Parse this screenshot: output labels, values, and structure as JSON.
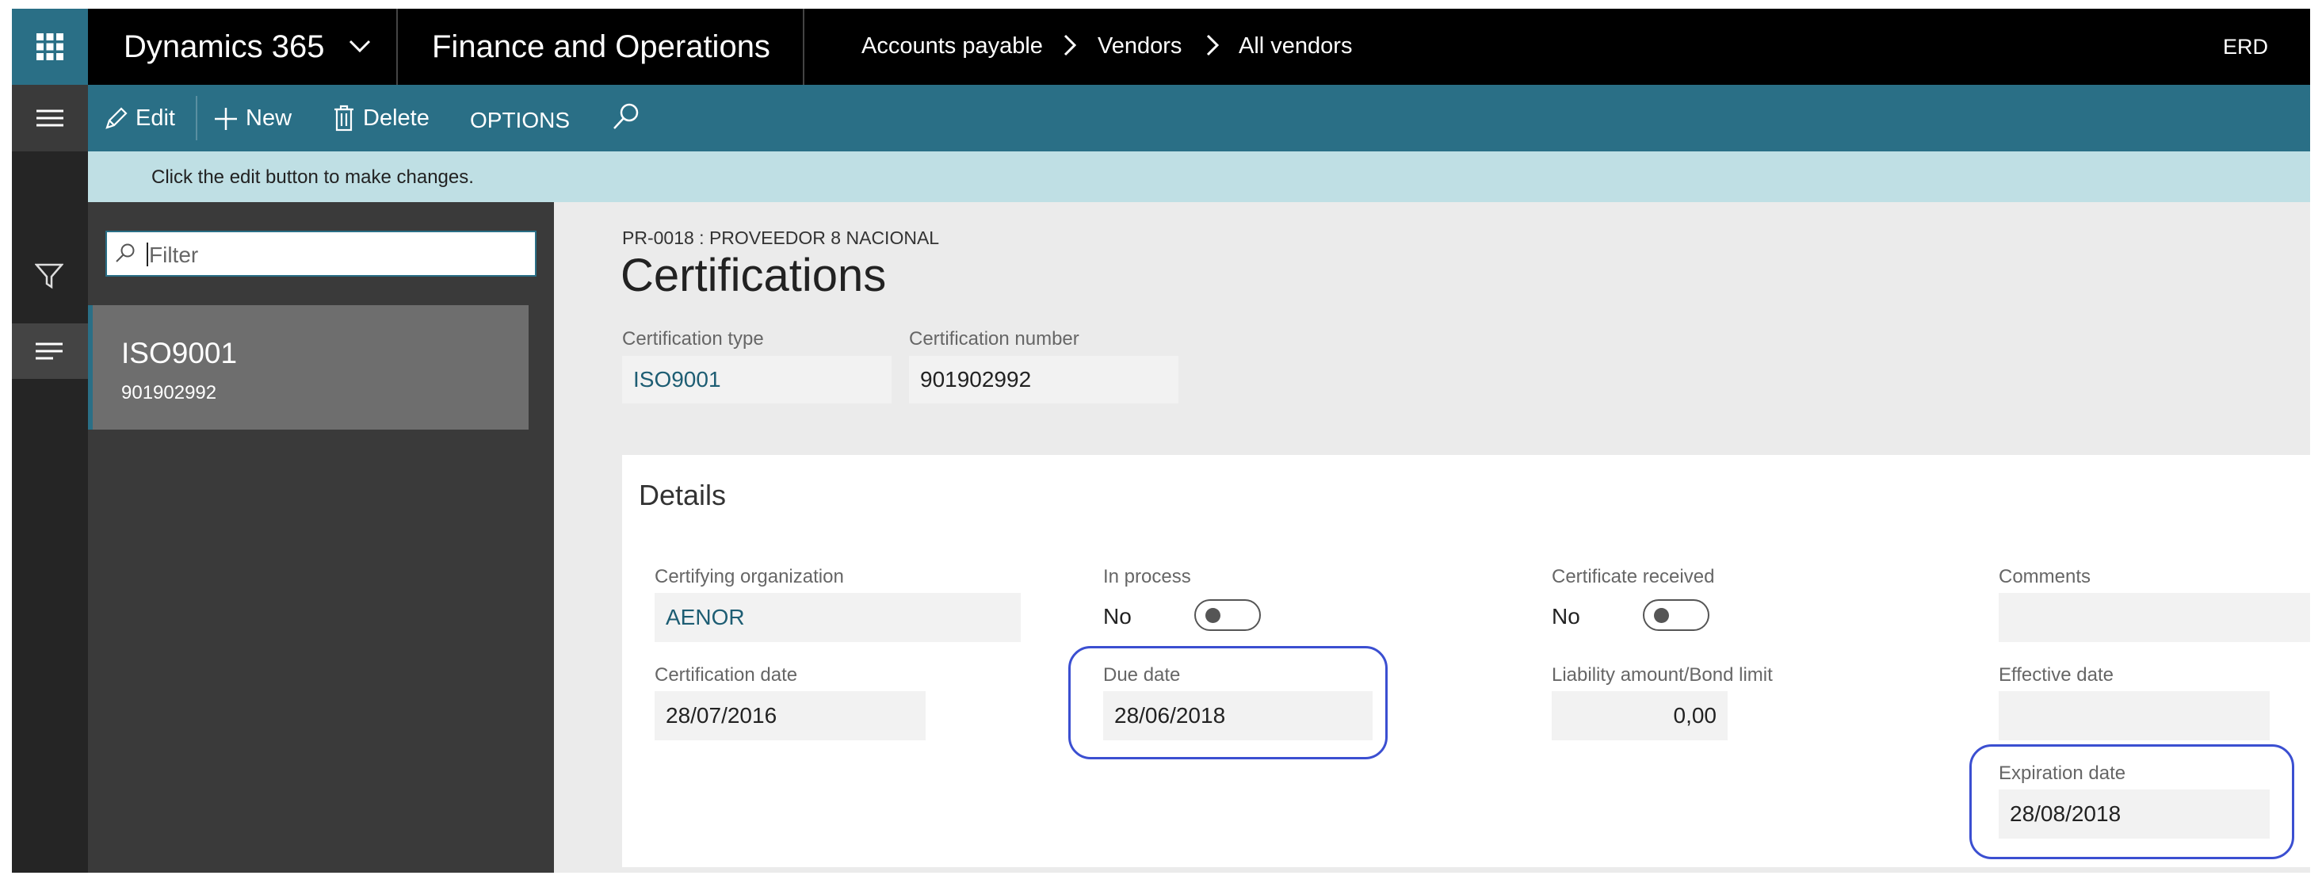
{
  "topbar": {
    "product": "Dynamics 365",
    "module": "Finance and Operations",
    "breadcrumb": [
      "Accounts payable",
      "Vendors",
      "All vendors"
    ],
    "company": "ERD"
  },
  "actions": {
    "edit": "Edit",
    "new": "New",
    "delete": "Delete",
    "options": "OPTIONS"
  },
  "info_message": "Click the edit button to make changes.",
  "list": {
    "filter_placeholder": "Filter",
    "items": [
      {
        "title": "ISO9001",
        "subtitle": "901902992"
      }
    ]
  },
  "record": {
    "context": "PR-0018 : PROVEEDOR 8 NACIONAL",
    "title": "Certifications",
    "certification_type_label": "Certification type",
    "certification_type_value": "ISO9001",
    "certification_number_label": "Certification number",
    "certification_number_value": "901902992"
  },
  "details": {
    "heading": "Details",
    "certifying_org_label": "Certifying organization",
    "certifying_org_value": "AENOR",
    "in_process_label": "In process",
    "in_process_value": "No",
    "certificate_received_label": "Certificate received",
    "certificate_received_value": "No",
    "comments_label": "Comments",
    "comments_value": "",
    "certification_date_label": "Certification date",
    "certification_date_value": "28/07/2016",
    "due_date_label": "Due date",
    "due_date_value": "28/06/2018",
    "liability_label": "Liability amount/Bond limit",
    "liability_value": "0,00",
    "effective_date_label": "Effective date",
    "effective_date_value": "",
    "expiration_date_label": "Expiration date",
    "expiration_date_value": "28/08/2018"
  },
  "colors": {
    "accent": "#2a6f86",
    "topbar": "#000000",
    "info_bar": "#bfdfe4",
    "highlight": "#3b4fd1"
  },
  "icons": [
    "waffle-icon",
    "chevron-down-icon",
    "chevron-right-icon",
    "hamburger-icon",
    "pencil-icon",
    "plus-icon",
    "trash-icon",
    "search-icon",
    "funnel-icon",
    "list-icon"
  ]
}
